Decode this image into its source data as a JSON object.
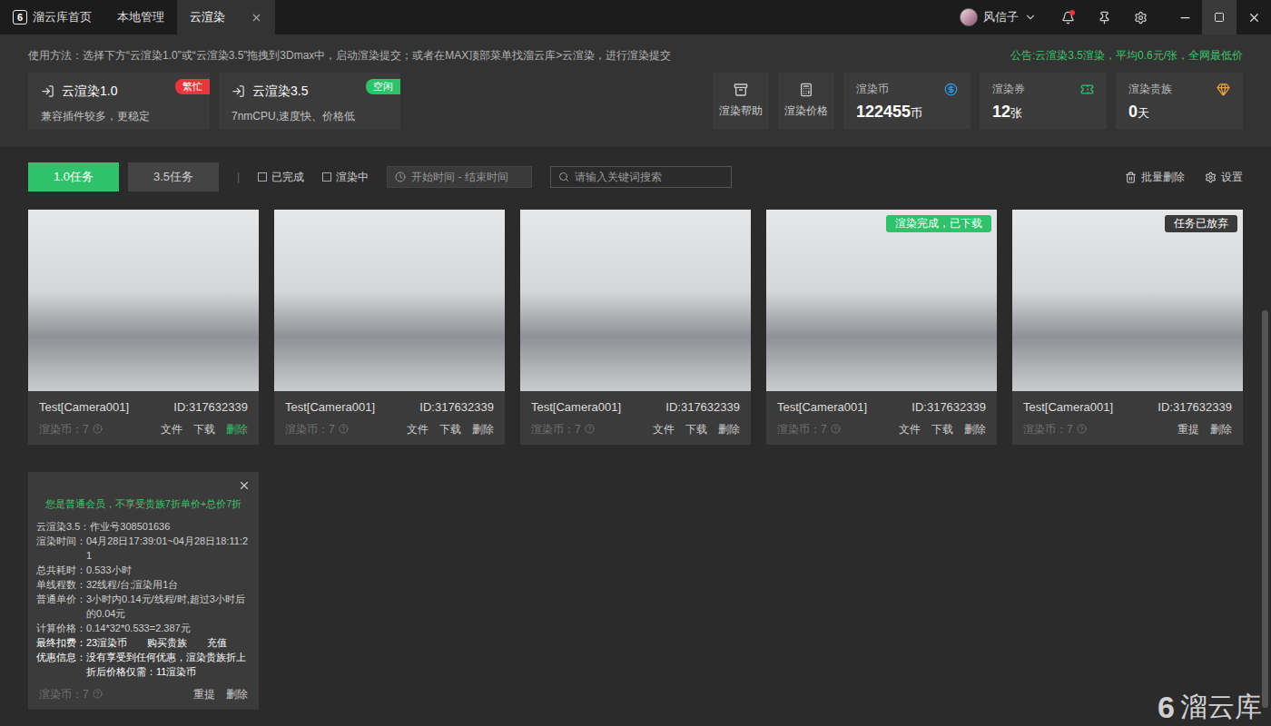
{
  "window": {
    "logo": "6",
    "tabs": [
      {
        "label": "溜云库首页",
        "selected": false,
        "closable": false,
        "logo": true
      },
      {
        "label": "本地管理",
        "selected": false,
        "closable": false,
        "logo": false
      },
      {
        "label": "云渲染",
        "selected": true,
        "closable": true,
        "logo": false
      }
    ],
    "user": {
      "name": "风信子"
    },
    "notifications": {
      "unread": true
    },
    "controls": [
      {
        "kind": "minimize",
        "highlighted": false
      },
      {
        "kind": "maximize",
        "highlighted": true
      },
      {
        "kind": "close",
        "highlighted": false
      }
    ]
  },
  "header": {
    "usage": "使用方法：选择下方“云渲染1.0”或“云渲染3.5”拖拽到3Dmax中，启动渲染提交；或者在MAX顶部菜单找溜云库>云渲染，进行渲染提交",
    "notice": "公告:云渲染3.5渲染，平均0.6元/张，全网最低价",
    "render_options": [
      {
        "title": "云渲染1.0",
        "badge": "繁忙",
        "color": "#e8363c",
        "desc": "兼容插件较多，更稳定"
      },
      {
        "title": "云渲染3.5",
        "badge": "空闲",
        "color": "#2fc26b",
        "desc": "7nmCPU,速度快、价格低"
      }
    ],
    "tools": [
      "渲染帮助",
      "渲染价格"
    ],
    "stats": [
      {
        "label": "渲染币",
        "value": "122455",
        "unit": "币"
      },
      {
        "label": "渲染券",
        "value": "12",
        "unit": "张"
      },
      {
        "label": "渲染贵族",
        "value": "0",
        "unit": "天"
      }
    ]
  },
  "filters": {
    "task_tabs": [
      {
        "label": "1.0任务",
        "selected": true
      },
      {
        "label": "3.5任务",
        "selected": false
      }
    ],
    "separator": "|",
    "checkboxes": [
      {
        "label": "已完成",
        "checked": false
      },
      {
        "label": "渲染中",
        "checked": false
      }
    ],
    "date_range": "开始时间 - 结束时间",
    "search_placeholder": "请输入关键词搜索",
    "actions": [
      {
        "label": "批量删除",
        "kind": "delete"
      },
      {
        "label": "设置",
        "kind": "settings"
      }
    ]
  },
  "tasks": [
    {
      "name": "Test[Camera001]",
      "id": "ID:317632339",
      "cost": "渲染币：7",
      "status": null,
      "actions": [
        {
          "label": "文件",
          "highlighted": false
        },
        {
          "label": "下载",
          "highlighted": false
        },
        {
          "label": "删除",
          "highlighted": true
        }
      ]
    },
    {
      "name": "Test[Camera001]",
      "id": "ID:317632339",
      "cost": "渲染币：7",
      "status": null,
      "actions": [
        {
          "label": "文件",
          "highlighted": false
        },
        {
          "label": "下载",
          "highlighted": false
        },
        {
          "label": "删除",
          "highlighted": false
        }
      ]
    },
    {
      "name": "Test[Camera001]",
      "id": "ID:317632339",
      "cost": "渲染币：7",
      "status": null,
      "actions": [
        {
          "label": "文件",
          "highlighted": false
        },
        {
          "label": "下载",
          "highlighted": false
        },
        {
          "label": "删除",
          "highlighted": false
        }
      ]
    },
    {
      "name": "Test[Camera001]",
      "id": "ID:317632339",
      "cost": "渲染币：7",
      "status": {
        "label": "渲染完成，已下载",
        "color": "#2fc26b"
      },
      "actions": [
        {
          "label": "文件",
          "highlighted": false
        },
        {
          "label": "下载",
          "highlighted": false
        },
        {
          "label": "删除",
          "highlighted": false
        }
      ]
    },
    {
      "name": "Test[Camera001]",
      "id": "ID:317632339",
      "cost": "渲染币：7",
      "status": {
        "label": "任务已放弃",
        "color": "#3a3a3a"
      },
      "actions": [
        {
          "label": "重提",
          "highlighted": false
        },
        {
          "label": "删除",
          "highlighted": false
        }
      ]
    }
  ],
  "detail": {
    "member_note": "您是普通会员，不享受贵族7折单价+总价7折",
    "rows": [
      {
        "label": "云渲染3.5：",
        "value": "作业号308501636",
        "kind": "normal"
      },
      {
        "label": "渲染时间：",
        "value": "04月28日17:39:01~04月28日18:11:21",
        "kind": "normal"
      },
      {
        "label": "总共耗时：",
        "value": "0.533小时",
        "kind": "normal"
      },
      {
        "label": "单线程数：",
        "value": "32线程/台;渲染用1台",
        "kind": "normal"
      },
      {
        "label": "普通单价：",
        "value": "3小时内0.14元/线程/时,超过3小时后的0.04元",
        "kind": "normal"
      },
      {
        "label": "计算价格：",
        "value": "0.14*32*0.533=2.387元",
        "kind": "normal"
      },
      {
        "label": "最终扣费：",
        "value": "23渲染币",
        "kind": "charge",
        "links": [
          "购买贵族",
          "充值"
        ]
      },
      {
        "label": "优惠信息：",
        "value": "没有享受到任何优惠，渲染贵族折上折后价格仅需：11渲染币",
        "kind": "emphasis"
      }
    ],
    "cost": "渲染币：7",
    "actions": [
      {
        "label": "重提",
        "highlighted": false
      },
      {
        "label": "删除",
        "highlighted": false
      }
    ]
  },
  "watermark": {
    "logo": "6",
    "text": "溜云库"
  },
  "scrollbar": {
    "level": 0.71
  }
}
